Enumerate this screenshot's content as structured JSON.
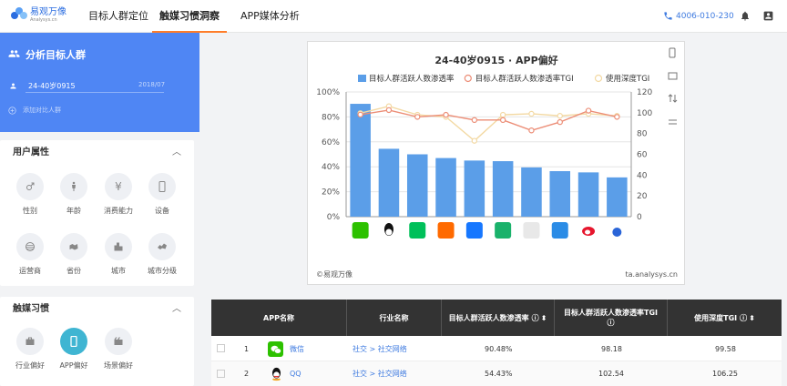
{
  "brand": {
    "name": "易观万像",
    "sub": "Analysys.cn"
  },
  "nav": [
    "目标人群定位",
    "触媒习惯洞察",
    "APP媒体分析"
  ],
  "header": {
    "phone": "4006-010-230"
  },
  "sidebar": {
    "title": "分析目标人群",
    "group_name": "24-40岁0915",
    "group_date": "2018/07",
    "add_compare": "添加对比人群",
    "user_attr": {
      "title": "用户属性",
      "items": [
        "性别",
        "年龄",
        "消费能力",
        "设备",
        "运营商",
        "省份",
        "城市",
        "城市分级"
      ]
    },
    "media": {
      "title": "触媒习惯",
      "items": [
        "行业偏好",
        "APP偏好",
        "场景偏好"
      ]
    }
  },
  "chart": {
    "footer_left": "©易观万像",
    "footer_right": "ta.analysys.cn"
  },
  "chart_data": {
    "type": "bar",
    "title": "24-40岁0915 · APP偏好",
    "categories": [
      "微信",
      "QQ",
      "爱奇艺",
      "淘宝",
      "支付宝",
      "腾讯视频",
      "优酷",
      "酷狗音乐",
      "新浪微博",
      "百度"
    ],
    "series": [
      {
        "name": "目标人群活跃人数渗透率",
        "values": [
          90.48,
          54.43,
          50,
          47,
          45,
          44.5,
          39.5,
          36.5,
          35.5,
          31.5
        ]
      },
      {
        "name": "目标人群活跃人数渗透率TGI",
        "values": [
          98.18,
          102.54,
          96,
          98,
          93,
          93,
          83,
          91,
          102,
          96
        ]
      },
      {
        "name": "使用深度TGI",
        "values": [
          99.58,
          106.25,
          98,
          96,
          73,
          98,
          99,
          97,
          99,
          97
        ]
      }
    ],
    "ylim_left": [
      0,
      100
    ],
    "yticks_left": [
      "0%",
      "20%",
      "40%",
      "60%",
      "80%",
      "100%"
    ],
    "ylim_right": [
      0,
      120
    ],
    "yticks_right": [
      "0",
      "20",
      "40",
      "60",
      "80",
      "100",
      "120"
    ],
    "colors": {
      "bar": "#5b9ee8",
      "tgi": "#ec8d76",
      "depth": "#f3d9a3"
    },
    "grid": true,
    "legend": "top"
  },
  "table": {
    "headers": [
      "APP名称",
      "行业名称",
      "目标人群活跃人数渗透率",
      "目标人群活跃人数渗透率TGI",
      "使用深度TGI"
    ],
    "rows": [
      {
        "rank": "1",
        "app": "微信",
        "industry": "社交 > 社交网络",
        "rate": "90.48%",
        "tgi": "98.18",
        "depth": "99.58"
      },
      {
        "rank": "2",
        "app": "QQ",
        "industry": "社交 > 社交网络",
        "rate": "54.43%",
        "tgi": "102.54",
        "depth": "106.25"
      }
    ]
  }
}
